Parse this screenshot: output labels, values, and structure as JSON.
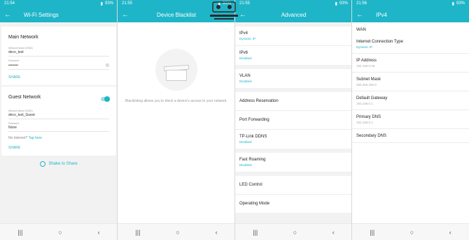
{
  "status": [
    {
      "time": "21:54",
      "battery": "93%"
    },
    {
      "time": "21:55",
      "battery": "93%"
    },
    {
      "time": "21:55",
      "battery": "93%"
    },
    {
      "time": "21:56",
      "battery": "93%"
    }
  ],
  "wifi_settings": {
    "title": "Wi-Fi Settings",
    "main": {
      "heading": "Main Network",
      "name_label": "Network Name (SSID)",
      "name_value": "deco_test",
      "password_label": "Password",
      "password_value": "••••••••",
      "share": "SHARE"
    },
    "guest": {
      "heading": "Guest Network",
      "name_label": "Network Name (SSID)",
      "name_value": "deco_test_Guest",
      "password_label": "Password",
      "password_value": "None",
      "no_internet": "No internet?",
      "tap_here": "Tap here",
      "share": "SHARE"
    },
    "shake": "Shake to Share"
  },
  "blacklist": {
    "title": "Device Blacklist",
    "empty_text": "Blacklisting allows you to block a device's access to your network."
  },
  "advanced": {
    "title": "Advanced",
    "groups": [
      [
        {
          "title": "IPv4",
          "sub": "Dynamic IP"
        },
        {
          "title": "IPv6",
          "sub": "Disabled"
        }
      ],
      [
        {
          "title": "VLAN",
          "sub": "Disabled"
        }
      ],
      [
        {
          "title": "Address Reservation",
          "sub": ""
        },
        {
          "title": "Port Forwarding",
          "sub": ""
        },
        {
          "title": "TP-Link DDNS",
          "sub": "Disabled"
        }
      ],
      [
        {
          "title": "Fast Roaming",
          "sub": "Disabled"
        }
      ],
      [
        {
          "title": "LED Control",
          "sub": ""
        },
        {
          "title": "Operating Mode",
          "sub": ""
        }
      ]
    ]
  },
  "ipv4": {
    "title": "IPv4",
    "section": "WAN",
    "rows": [
      {
        "title": "Internet Connection Type",
        "sub": "Dynamic IP",
        "accent": true
      },
      {
        "title": "IP Address",
        "sub": "192.168.0.26"
      },
      {
        "title": "Subnet Mask",
        "sub": "255.255.255.0"
      },
      {
        "title": "Default Gateway",
        "sub": "192.168.0.1"
      },
      {
        "title": "Primary DNS",
        "sub": "192.168.0.1"
      },
      {
        "title": "Secondary DNS",
        "sub": ""
      }
    ]
  },
  "nav": {
    "recents": "|||",
    "home": "○",
    "back": "‹"
  },
  "colors": {
    "accent": "#1fb5c8"
  }
}
